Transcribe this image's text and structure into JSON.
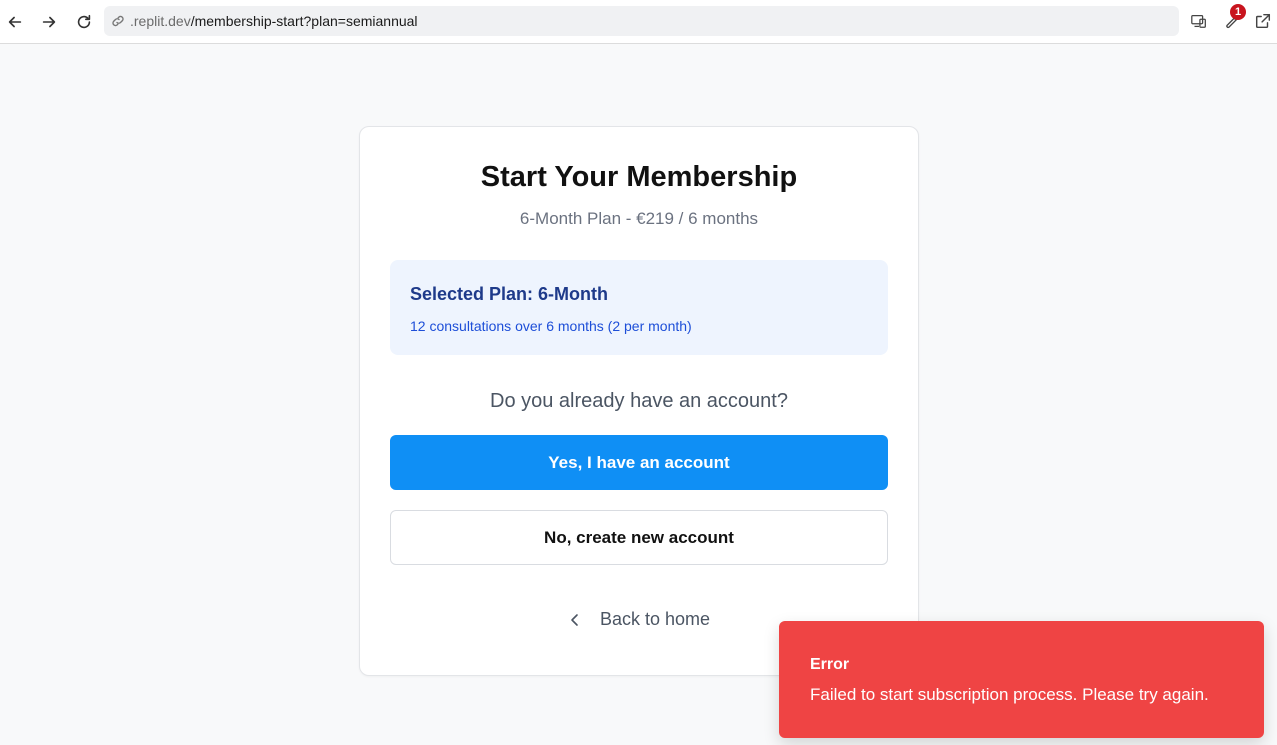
{
  "browser": {
    "url_domain": ".replit.dev",
    "url_path": "/membership-start?plan=semiannual",
    "extensions_badge": "1",
    "icons": [
      "back-arrow-icon",
      "forward-arrow-icon",
      "reload-icon",
      "link-icon",
      "devices-icon",
      "wrench-icon",
      "external-link-icon"
    ]
  },
  "card": {
    "title": "Start Your Membership",
    "subtitle": "6-Month Plan - €219 / 6 months",
    "plan": {
      "title": "Selected Plan: 6-Month",
      "description": "12 consultations over 6 months (2 per month)"
    },
    "question": "Do you already have an account?",
    "primary_button": "Yes, I have an account",
    "secondary_button": "No, create new account",
    "back_link": "Back to home"
  },
  "toast": {
    "title": "Error",
    "message": "Failed to start subscription process. Please try again."
  },
  "colors": {
    "primary": "#0f8ff5",
    "error": "#ef4444",
    "plan_bg": "#eef4fe",
    "plan_title": "#1e3a8a"
  }
}
